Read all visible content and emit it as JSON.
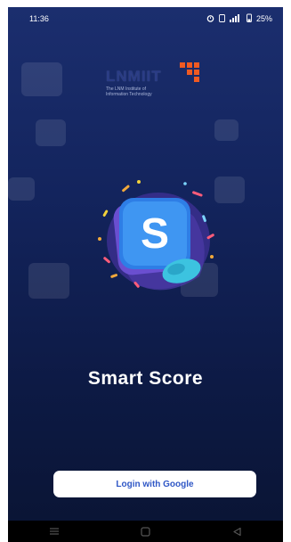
{
  "status_bar": {
    "time": "11:36",
    "icons": [
      "alarm-icon",
      "sim-icon",
      "signal-icon",
      "battery-icon"
    ],
    "battery": "25%"
  },
  "logo": {
    "name": "LNMIIT",
    "subtitle_line1": "The LNM Institute of",
    "subtitle_line2": "Information Technology",
    "accent_color": "#f05a22"
  },
  "app": {
    "icon_letter": "S",
    "title": "Smart Score"
  },
  "login": {
    "button_label": "Login with Google"
  },
  "nav_bar": {
    "icons": [
      "menu-icon",
      "home-icon",
      "back-icon"
    ]
  },
  "colors": {
    "background_top": "#1b2e6e",
    "background_bottom": "#0a1433",
    "button_text": "#2f57c6"
  }
}
